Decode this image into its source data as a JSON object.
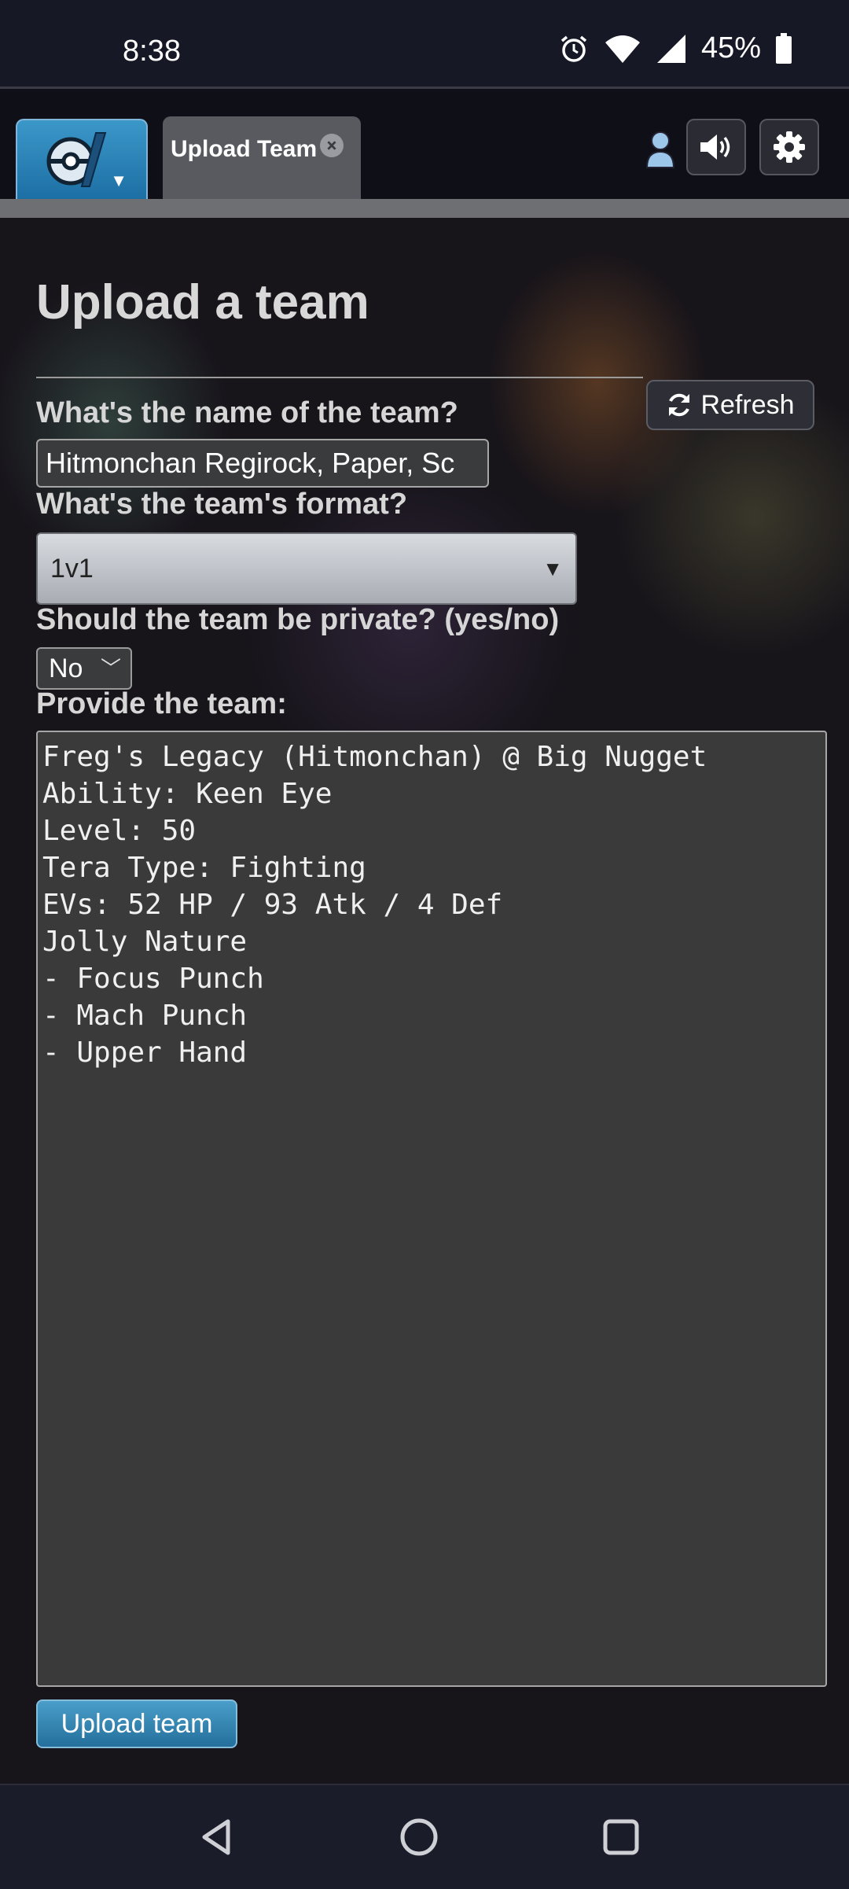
{
  "status_bar": {
    "time": "8:38",
    "battery": "45%",
    "icons": [
      "alarm-icon",
      "wifi-icon",
      "signal-icon",
      "battery-icon"
    ]
  },
  "header": {
    "tab_label": "Upload Team",
    "tab_close": "×",
    "icons": [
      "pokeball-logo-icon",
      "user-icon",
      "sound-icon",
      "gear-icon"
    ]
  },
  "page": {
    "title": "Upload a team",
    "refresh_label": "Refresh",
    "name_label": "What's the name of the team?",
    "name_value": "Hitmonchan Regirock, Paper, Sc",
    "format_label": "What's the team's format?",
    "format_value": "1v1",
    "private_label": "Should the team be private? (yes/no)",
    "private_value": "No",
    "team_label": "Provide the team:",
    "team_text": "Freg's Legacy (Hitmonchan) @ Big Nugget\nAbility: Keen Eye\nLevel: 50\nTera Type: Fighting\nEVs: 52 HP / 93 Atk / 4 Def\nJolly Nature\n- Focus Punch\n- Mach Punch\n- Upper Hand",
    "upload_label": "Upload team"
  },
  "colors": {
    "accent_blue": "#2f86b8",
    "background": "#14151f",
    "textarea_bg": "#3a3a3a"
  }
}
